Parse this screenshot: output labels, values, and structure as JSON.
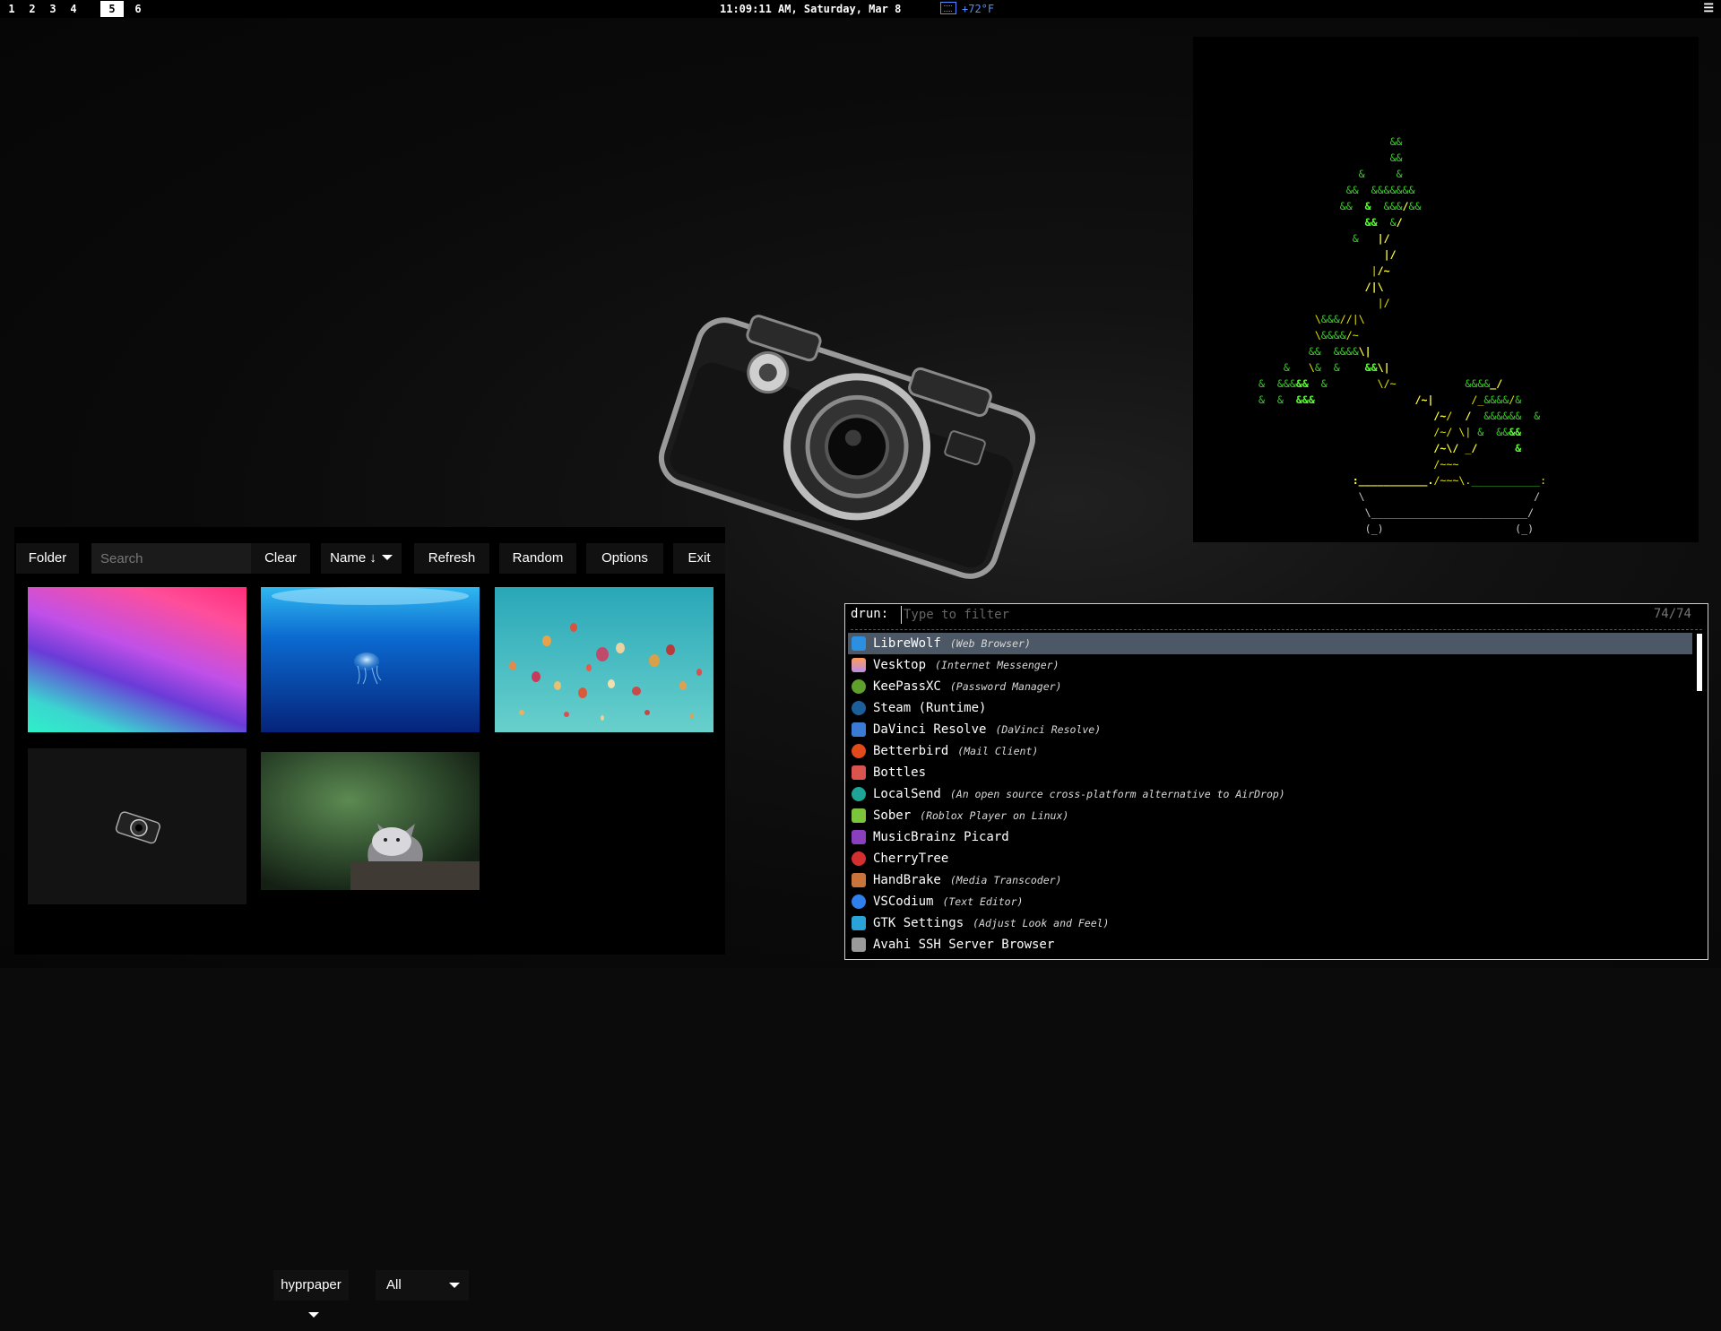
{
  "topbar": {
    "workspaces": [
      "1",
      "2",
      "3",
      "4",
      "5",
      "6"
    ],
    "active_workspace": "5",
    "clock": "11:09:11 AM, Saturday, Mar 8",
    "weather_icon": "weather-icon",
    "temperature": "+72°F",
    "menu_icon": "menu-icon",
    "accent_color": "#4d8dff"
  },
  "picker": {
    "folder_label": "Folder",
    "search_placeholder": "Search",
    "clear_label": "Clear",
    "sort_label": "Name ↓",
    "refresh_label": "Refresh",
    "random_label": "Random",
    "options_label": "Options",
    "exit_label": "Exit",
    "thumbnails": [
      "gradient-wallpaper",
      "jellyfish-wallpaper",
      "balloons-wallpaper",
      "camera-wallpaper",
      "cat-figurine-wallpaper"
    ],
    "backend_select": "hyprpaper",
    "monitor_select": "All"
  },
  "drun": {
    "prompt": "drun:",
    "placeholder": "Type to filter",
    "count": "74/74",
    "items": [
      {
        "name": "LibreWolf",
        "desc": "(Web Browser)",
        "icon": "librewolf-icon",
        "color": "#2c8fe0"
      },
      {
        "name": "Vesktop",
        "desc": "(Internet Messenger)",
        "icon": "vesktop-icon",
        "color": "#b98ee8"
      },
      {
        "name": "KeePassXC",
        "desc": "(Password Manager)",
        "icon": "keepassxc-icon",
        "color": "#5fa02c"
      },
      {
        "name": "Steam (Runtime)",
        "desc": "",
        "icon": "steam-icon",
        "color": "#1b5e9a"
      },
      {
        "name": "DaVinci Resolve",
        "desc": "(DaVinci Resolve)",
        "icon": "davinci-resolve-icon",
        "color": "#3a7bd5"
      },
      {
        "name": "Betterbird",
        "desc": "(Mail Client)",
        "icon": "betterbird-icon",
        "color": "#e24a1b"
      },
      {
        "name": "Bottles",
        "desc": "",
        "icon": "bottles-icon",
        "color": "#d9534f"
      },
      {
        "name": "LocalSend",
        "desc": "(An open source cross-platform alternative to AirDrop)",
        "icon": "localsend-icon",
        "color": "#1fa596"
      },
      {
        "name": "Sober",
        "desc": "(Roblox Player on Linux)",
        "icon": "sober-icon",
        "color": "#7cc43b"
      },
      {
        "name": "MusicBrainz Picard",
        "desc": "",
        "icon": "picard-icon",
        "color": "#8a3fbf"
      },
      {
        "name": "CherryTree",
        "desc": "",
        "icon": "cherrytree-icon",
        "color": "#d32f2f"
      },
      {
        "name": "HandBrake",
        "desc": "(Media Transcoder)",
        "icon": "handbrake-icon",
        "color": "#c9743a"
      },
      {
        "name": "VSCodium",
        "desc": "(Text Editor)",
        "icon": "vscodium-icon",
        "color": "#2f80ed"
      },
      {
        "name": "GTK Settings",
        "desc": "(Adjust Look and Feel)",
        "icon": "gtk-settings-icon",
        "color": "#2aa4d8"
      },
      {
        "name": "Avahi SSH Server Browser",
        "desc": "",
        "icon": "avahi-icon",
        "color": "#9a9a9a"
      }
    ]
  }
}
